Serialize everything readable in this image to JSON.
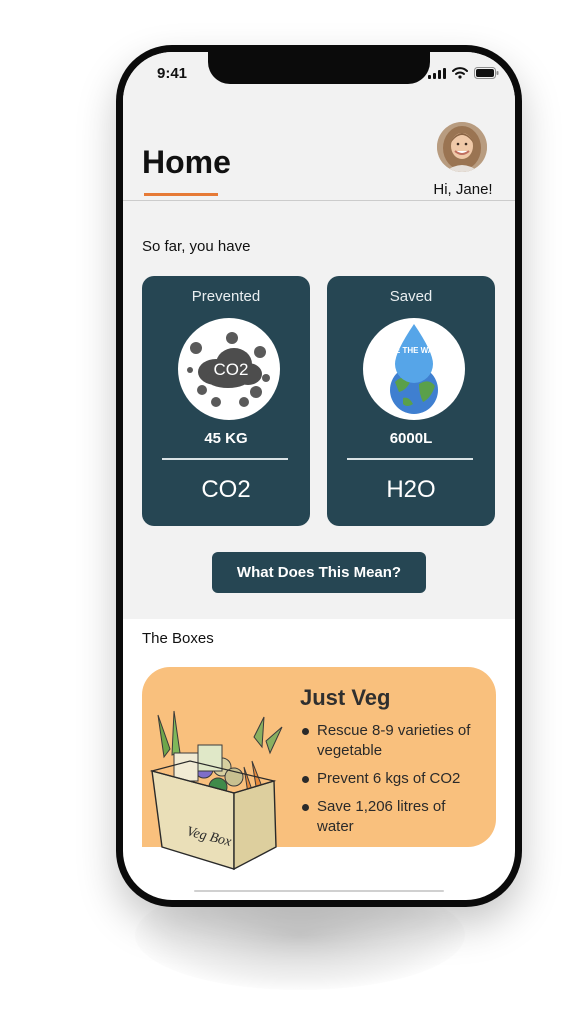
{
  "status_bar": {
    "time": "9:41"
  },
  "header": {
    "title": "Home",
    "greeting": "Hi, Jane!"
  },
  "intro": {
    "text": "So far, you have"
  },
  "stats": [
    {
      "label": "Prevented",
      "value": "45 KG",
      "unit": "CO2",
      "illustration": "co2-cloud-icon",
      "badge_text": "CO2"
    },
    {
      "label": "Saved",
      "value": "6000L",
      "unit": "H2O",
      "illustration": "water-drop-earth-icon",
      "badge_text": "SAVE THE WATER"
    }
  ],
  "actions": {
    "what_label": "What Does This Mean?"
  },
  "boxes": {
    "heading": "The Boxes",
    "items": [
      {
        "title": "Just Veg",
        "bullets": [
          "Rescue 8-9 varieties of vegetable",
          "Prevent 6 kgs of CO2",
          "Save 1,206  litres of water"
        ],
        "art_label": "Veg Box"
      }
    ]
  },
  "colors": {
    "accent": "#e67a36",
    "card": "#264653",
    "box": "#f9c07d",
    "background": "#f2f2f2"
  }
}
